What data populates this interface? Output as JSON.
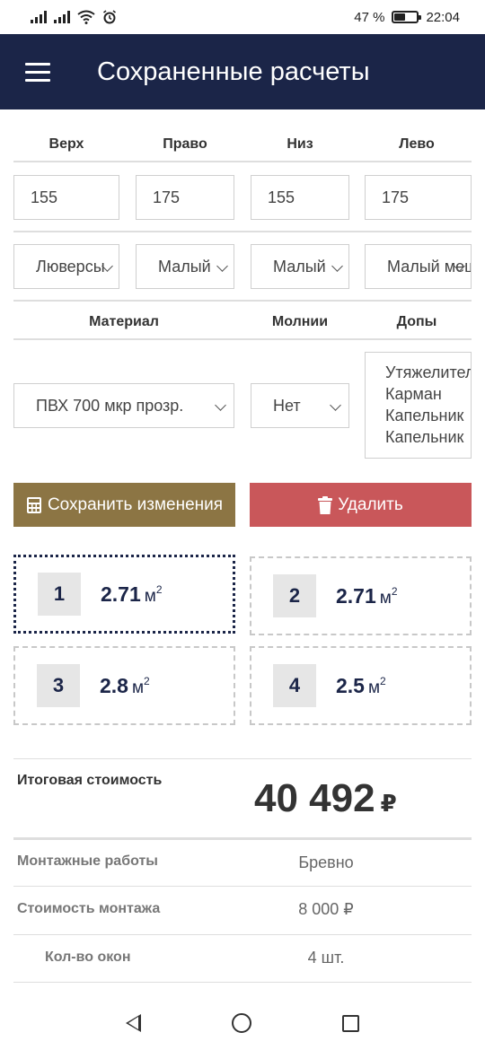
{
  "status_bar": {
    "battery": "47 %",
    "time": "22:04",
    "battery_level": 0.47
  },
  "app_bar": {
    "title": "Сохраненные расчеты"
  },
  "sides": {
    "labels": [
      "Верх",
      "Право",
      "Низ",
      "Лево"
    ],
    "values": [
      "155",
      "175",
      "155",
      "175"
    ],
    "fastenings": [
      "Люверсы",
      "Малый",
      "Малый",
      "Малый мешок"
    ]
  },
  "options": {
    "material_label": "Материал",
    "zippers_label": "Молнии",
    "extras_label": "Допы",
    "material_value": "ПВХ 700 мкр прозр.",
    "zippers_value": "Нет",
    "extras_items": [
      "Утяжелитель",
      "Карман",
      "Капельник",
      "Капельник"
    ]
  },
  "actions": {
    "save_label": "Сохранить изменения",
    "delete_label": "Удалить"
  },
  "windows": [
    {
      "num": "1",
      "area": "2.71",
      "unit": "м",
      "active": true
    },
    {
      "num": "2",
      "area": "2.71",
      "unit": "м",
      "active": false
    },
    {
      "num": "3",
      "area": "2.8",
      "unit": "м",
      "active": false
    },
    {
      "num": "4",
      "area": "2.5",
      "unit": "м",
      "active": false
    }
  ],
  "unit_exp": "2",
  "summary": {
    "total_label": "Итоговая стоимость",
    "total_value": "40 492",
    "currency": "₽",
    "rows": [
      {
        "label": "Монтажные работы",
        "value": "Бревно"
      },
      {
        "label": "Стоимость монтажа",
        "value": "8 000 ₽"
      },
      {
        "label": "Кол-во окон",
        "value": "4 шт."
      }
    ]
  },
  "colors": {
    "app_bar": "#1b2548",
    "save": "#8c7544",
    "delete": "#c9575a"
  }
}
